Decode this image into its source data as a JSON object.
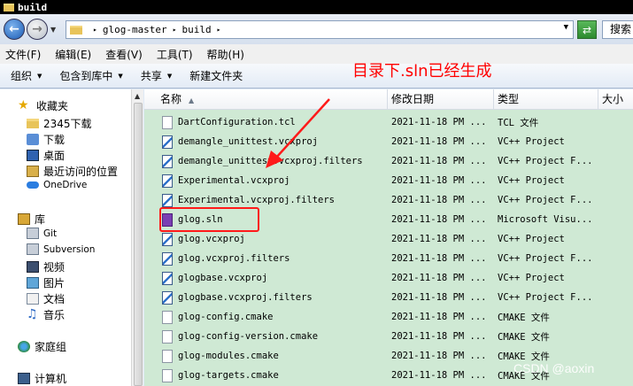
{
  "window": {
    "title": "build"
  },
  "address": {
    "crumbs": [
      "glog-master",
      "build"
    ],
    "search_placeholder": "搜索"
  },
  "menu": [
    "文件(F)",
    "编辑(E)",
    "查看(V)",
    "工具(T)",
    "帮助(H)"
  ],
  "toolbar": [
    "组织",
    "包含到库中",
    "共享",
    "新建文件夹"
  ],
  "annotation": "目录下.sln已经生成",
  "sidebar": {
    "favorites": "收藏夹",
    "fav_items": [
      "2345下载",
      "下载",
      "桌面",
      "最近访问的位置",
      "OneDrive"
    ],
    "libraries": "库",
    "lib_items": [
      "Git",
      "Subversion",
      "视频",
      "图片",
      "文档",
      "音乐"
    ],
    "homegroup": "家庭组",
    "computer": "计算机"
  },
  "columns": {
    "name": "名称",
    "date": "修改日期",
    "type": "类型",
    "size": "大小"
  },
  "files": [
    {
      "name": "DartConfiguration.tcl",
      "date": "2021-11-18 PM ...",
      "type": "TCL 文件",
      "icon": "generic-file-icon"
    },
    {
      "name": "demangle_unittest.vcxproj",
      "date": "2021-11-18 PM ...",
      "type": "VC++ Project",
      "icon": "vcxproj-file-icon"
    },
    {
      "name": "demangle_unittest.vcxproj.filters",
      "date": "2021-11-18 PM ...",
      "type": "VC++ Project F...",
      "icon": "vcxproj-file-icon"
    },
    {
      "name": "Experimental.vcxproj",
      "date": "2021-11-18 PM ...",
      "type": "VC++ Project",
      "icon": "vcxproj-file-icon"
    },
    {
      "name": "Experimental.vcxproj.filters",
      "date": "2021-11-18 PM ...",
      "type": "VC++ Project F...",
      "icon": "vcxproj-file-icon"
    },
    {
      "name": "glog.sln",
      "date": "2021-11-18 PM ...",
      "type": "Microsoft Visu...",
      "icon": "sln-file-icon"
    },
    {
      "name": "glog.vcxproj",
      "date": "2021-11-18 PM ...",
      "type": "VC++ Project",
      "icon": "vcxproj-file-icon"
    },
    {
      "name": "glog.vcxproj.filters",
      "date": "2021-11-18 PM ...",
      "type": "VC++ Project F...",
      "icon": "vcxproj-file-icon"
    },
    {
      "name": "glogbase.vcxproj",
      "date": "2021-11-18 PM ...",
      "type": "VC++ Project",
      "icon": "vcxproj-file-icon"
    },
    {
      "name": "glogbase.vcxproj.filters",
      "date": "2021-11-18 PM ...",
      "type": "VC++ Project F...",
      "icon": "vcxproj-file-icon"
    },
    {
      "name": "glog-config.cmake",
      "date": "2021-11-18 PM ...",
      "type": "CMAKE 文件",
      "icon": "generic-file-icon"
    },
    {
      "name": "glog-config-version.cmake",
      "date": "2021-11-18 PM ...",
      "type": "CMAKE 文件",
      "icon": "generic-file-icon"
    },
    {
      "name": "glog-modules.cmake",
      "date": "2021-11-18 PM ...",
      "type": "CMAKE 文件",
      "icon": "generic-file-icon"
    },
    {
      "name": "glog-targets.cmake",
      "date": "2021-11-18 PM ...",
      "type": "CMAKE 文件",
      "icon": "generic-file-icon"
    }
  ],
  "watermark": "CSDN @aoxin",
  "colors": {
    "annotation": "#ff0000",
    "list_bg": "#cfe9d4",
    "highlight": "#ff1a1a"
  }
}
